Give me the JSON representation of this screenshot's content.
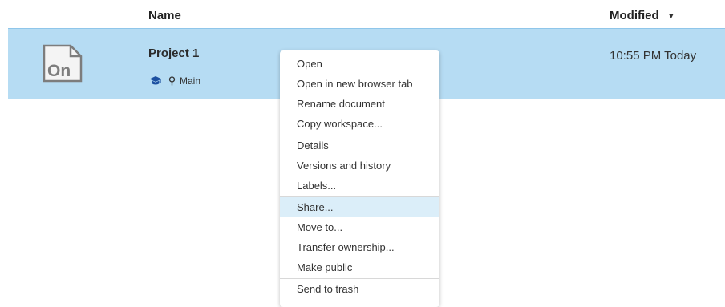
{
  "header": {
    "name_label": "Name",
    "modified_label": "Modified",
    "sort_indicator": "▼"
  },
  "document": {
    "name": "Project 1",
    "branch": "Main",
    "modified": "10:55 PM Today",
    "thumbnail_text": "On",
    "row_color": "#b6dcf3"
  },
  "context_menu": {
    "groups": [
      [
        "Open",
        "Open in new browser tab",
        "Rename document",
        "Copy workspace..."
      ],
      [
        "Details",
        "Versions and history",
        "Labels..."
      ],
      [
        "Share...",
        "Move to...",
        "Transfer ownership...",
        "Make public"
      ],
      [
        "Send to trash"
      ]
    ],
    "highlighted_item": "Share...",
    "highlight_color": "#dbeef9"
  },
  "icons": {
    "thumbnail": "onshape-document-icon",
    "edu": "graduation-cap-icon",
    "branch": "map-pin-icon",
    "sort": "sort-descending-icon"
  }
}
